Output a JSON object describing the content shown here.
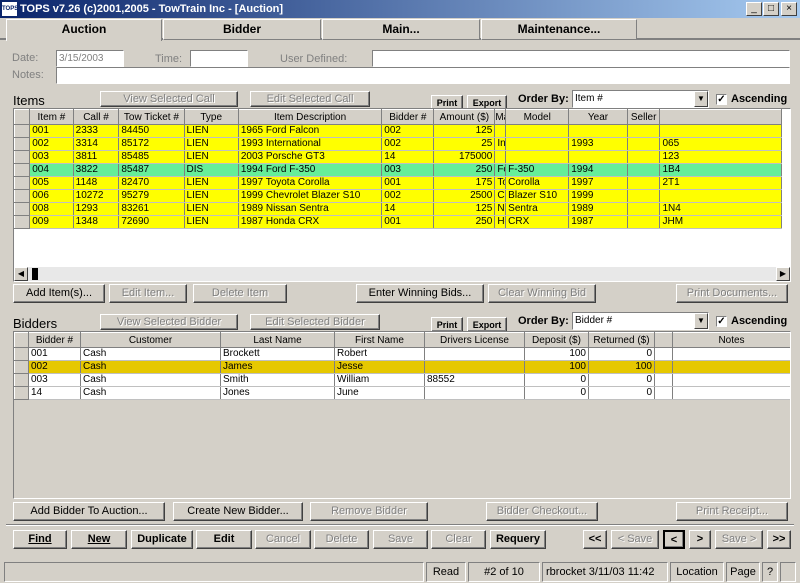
{
  "window": {
    "title": "TOPS v7.26 (c)2001,2005 - TowTrain Inc - [Auction]",
    "icon": "TOPS"
  },
  "tabs": [
    {
      "label": "Auction"
    },
    {
      "label": "Bidder"
    },
    {
      "label": "Main..."
    },
    {
      "label": "Maintenance..."
    }
  ],
  "header": {
    "date_label": "Date:",
    "date_value": "3/15/2003",
    "time_label": "Time:",
    "time_value": "",
    "user_defined_label": "User Defined:",
    "user_defined_value": "",
    "notes_label": "Notes:",
    "notes_value": ""
  },
  "items": {
    "title": "Items",
    "view_call": "View Selected Call",
    "edit_call": "Edit Selected Call",
    "print": "Print",
    "export": "Export",
    "order_by_label": "Order By:",
    "order_by_value": "Item #",
    "ascending_label": "Ascending",
    "columns": [
      "Item #",
      "Call #",
      "Tow Ticket #",
      "Type",
      "Item Description",
      "Bidder #",
      "Amount ($)",
      "Make",
      "Model",
      "Year",
      "Seller",
      ""
    ],
    "rows": [
      {
        "c": [
          "001",
          "2333",
          "84450",
          "LIEN",
          "1965 Ford Falcon",
          "002",
          "125",
          "",
          "",
          "",
          "",
          ""
        ],
        "color": "y"
      },
      {
        "c": [
          "002",
          "3314",
          "85172",
          "LIEN",
          "1993 International",
          "002",
          "25",
          "International",
          "",
          "1993",
          "",
          "065"
        ],
        "color": "y"
      },
      {
        "c": [
          "003",
          "3811",
          "85485",
          "LIEN",
          "2003 Porsche GT3",
          "14",
          "175000",
          "",
          "",
          "",
          "",
          "123"
        ],
        "color": "y"
      },
      {
        "c": [
          "004",
          "3822",
          "85487",
          "DIS",
          "1994 Ford F-350",
          "003",
          "250",
          "Ford",
          "F-350",
          "1994",
          "",
          "1B4"
        ],
        "color": "g"
      },
      {
        "c": [
          "005",
          "1148",
          "82470",
          "LIEN",
          "1997 Toyota Corolla",
          "001",
          "175",
          "Toyota",
          "Corolla",
          "1997",
          "",
          "2T1"
        ],
        "color": "y"
      },
      {
        "c": [
          "006",
          "10272",
          "95279",
          "LIEN",
          "1999 Chevrolet Blazer S10",
          "002",
          "2500",
          "Chevrolet",
          "Blazer S10",
          "1999",
          "",
          ""
        ],
        "color": "y"
      },
      {
        "c": [
          "008",
          "1293",
          "83261",
          "LIEN",
          "1989 Nissan Sentra",
          "14",
          "125",
          "Nissan",
          "Sentra",
          "1989",
          "",
          "1N4"
        ],
        "color": "y"
      },
      {
        "c": [
          "009",
          "1348",
          "72690",
          "LIEN",
          "1987 Honda CRX",
          "001",
          "250",
          "Honda",
          "CRX",
          "1987",
          "",
          "JHM"
        ],
        "color": "y"
      }
    ],
    "add_item": "Add Item(s)...",
    "edit_item": "Edit Item...",
    "delete_item": "Delete Item",
    "enter_winning_bids": "Enter Winning Bids...",
    "clear_winning_bid": "Clear Winning Bid",
    "print_documents": "Print Documents..."
  },
  "bidders": {
    "title": "Bidders",
    "view_bidder": "View Selected Bidder",
    "edit_bidder": "Edit Selected Bidder",
    "print": "Print",
    "export": "Export",
    "order_by_label": "Order By:",
    "order_by_value": "Bidder #",
    "ascending_label": "Ascending",
    "columns": [
      "Bidder #",
      "Customer",
      "Last Name",
      "First Name",
      "Drivers License",
      "Deposit ($)",
      "Returned ($)",
      "",
      "Notes"
    ],
    "rows": [
      {
        "c": [
          "001",
          "Cash",
          "Brockett",
          "Robert",
          "",
          "100",
          "0",
          "",
          ""
        ],
        "color": "w"
      },
      {
        "c": [
          "002",
          "Cash",
          "James",
          "Jesse",
          "",
          "100",
          "100",
          "",
          ""
        ],
        "color": "o"
      },
      {
        "c": [
          "003",
          "Cash",
          "Smith",
          "William",
          "88552",
          "0",
          "0",
          "",
          ""
        ],
        "color": "w"
      },
      {
        "c": [
          "14",
          "Cash",
          "Jones",
          "June",
          "",
          "0",
          "0",
          "",
          ""
        ],
        "color": "w"
      }
    ],
    "add_bidder": "Add Bidder To Auction...",
    "create_bidder": "Create New Bidder...",
    "remove_bidder": "Remove Bidder",
    "bidder_checkout": "Bidder Checkout...",
    "print_receipt": "Print Receipt..."
  },
  "toolbar": {
    "find": "Find",
    "new": "New",
    "duplicate": "Duplicate",
    "edit": "Edit",
    "cancel": "Cancel",
    "delete": "Delete",
    "save": "Save",
    "clear": "Clear",
    "requery": "Requery",
    "first": "<<",
    "save_prev": "< Save",
    "prev": "<",
    "next": ">",
    "save_next": "Save >",
    "last": ">>"
  },
  "status": {
    "mode": "Read",
    "record": "#2 of 10",
    "user": "rbrocket 3/11/03 11:42",
    "location": "Location",
    "page": "Page",
    "help": "?"
  }
}
